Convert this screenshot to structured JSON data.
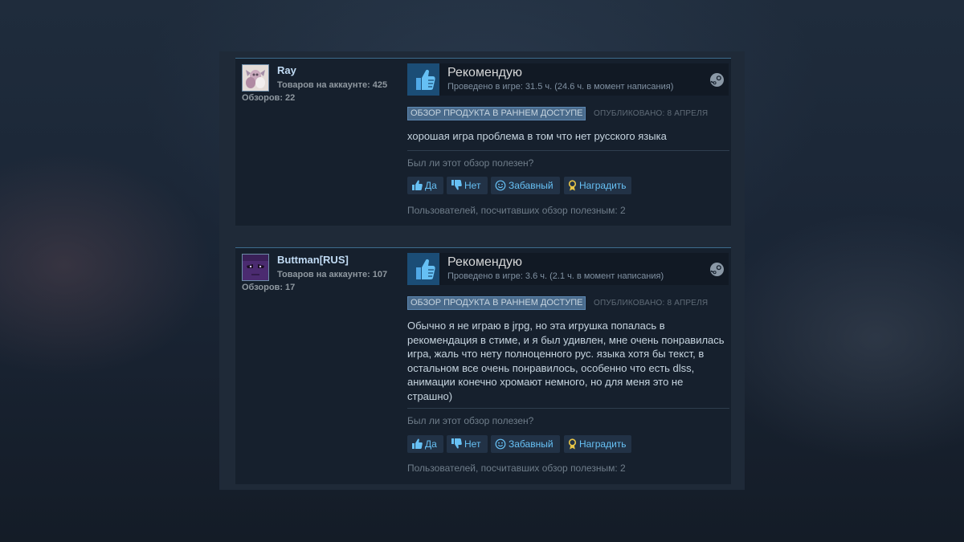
{
  "reviews": [
    {
      "author": "Ray",
      "products_owned": "Товаров на аккаунте: 425",
      "reviews_count": "Обзоров: 22",
      "verdict": "Рекомендую",
      "hours": "Проведено в игре: 31.5 ч. (24.6 ч. в момент написания)",
      "early_access_badge": "ОБЗОР ПРОДУКТА В РАННЕМ ДОСТУПЕ",
      "posted": "ОПУБЛИКОВАНО: 8 АПРЕЛЯ",
      "text": "хорошая игра проблема в том что нет русского языка",
      "helpful_question": "Был ли этот обзор полезен?",
      "btn_yes": "Да",
      "btn_no": "Нет",
      "btn_funny": "Забавный",
      "btn_award": "Наградить",
      "helpful_count": "Пользователей, посчитавших обзор полезным: 2"
    },
    {
      "author": "Buttman[RUS]",
      "products_owned": "Товаров на аккаунте: 107",
      "reviews_count": "Обзоров: 17",
      "verdict": "Рекомендую",
      "hours": "Проведено в игре: 3.6 ч. (2.1 ч. в момент написания)",
      "early_access_badge": "ОБЗОР ПРОДУКТА В РАННЕМ ДОСТУПЕ",
      "posted": "ОПУБЛИКОВАНО: 8 АПРЕЛЯ",
      "text": "Обычно я не играю в jrpg, но эта игрушка попалась в рекомендация в стиме, и я был удивлен, мне очень понравилась игра, жаль что нету полноценного рус. языка хотя бы текст, в остальном все очень понравилось, особенно что есть dlss, анимации конечно хромают немного, но для меня это не страшно)",
      "helpful_question": "Был ли этот обзор полезен?",
      "btn_yes": "Да",
      "btn_no": "Нет",
      "btn_funny": "Забавный",
      "btn_award": "Наградить",
      "helpful_count": "Пользователей, посчитавших обзор полезным: 2"
    }
  ],
  "icons": {
    "thumb": "thumbs-up-icon",
    "platform": "steam-icon",
    "yes": "thumbs-up-small-icon",
    "no": "thumbs-down-small-icon",
    "funny": "smiley-icon",
    "award": "award-ribbon-icon"
  },
  "colors": {
    "card_bg": "#16202d",
    "accent_blue": "#67c1f5",
    "recommend_box": "#1b4d76",
    "badge_bg": "#4a6b8c",
    "award_gold": "#e8c547"
  }
}
